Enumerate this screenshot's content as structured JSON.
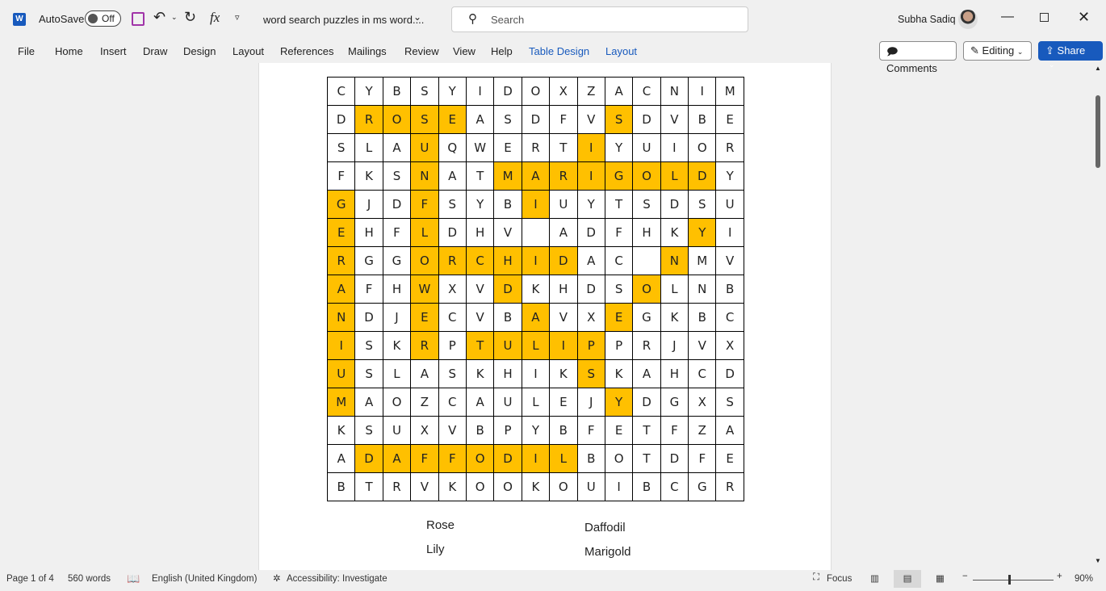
{
  "titlebar": {
    "autosave_label": "AutoSave",
    "autosave_state": "Off",
    "doc_title": "word search puzzles in ms word....",
    "search_placeholder": "Search",
    "user_name": "Subha Sadiq"
  },
  "menu": [
    "File",
    "Home",
    "Insert",
    "Draw",
    "Design",
    "Layout",
    "References",
    "Mailings",
    "Review",
    "View",
    "Help",
    "Table Design",
    "Layout"
  ],
  "actions": {
    "comments": "Comments",
    "editing": "Editing",
    "share": "Share"
  },
  "colors": {
    "highlight": "#ffc000",
    "accent": "#185abd",
    "contextual_tab": "#185abd"
  },
  "grid": {
    "rows": [
      "CYBSYIDOXZACNIM",
      "DROSEASDFVSDVBE",
      "SLAUQWERTIYUIOR",
      "FKSNATMARIGOLDY",
      "GJDFSYBIUYTSDSU",
      "EHFLDHV ADFHKYI",
      "RGGORCHIDAC NMV",
      "AFHWXVDKHDSOLNB",
      "NDJECVBAVXEGKBC",
      "ISKRPTULIPPRJVX",
      "USLASKHIKSKAHCD",
      "MAOZCAULEJYDGXS",
      "KSUXVBPYBFETFZA",
      "ADAFFODILBOTDFE",
      "BTRVKOOKOUIBCGR"
    ],
    "highlight_mask": [
      "000000000000000",
      "011110000010000",
      "000100000100000",
      "000100111111110",
      "100100010000000",
      "100100000000010",
      "100111111000100",
      "100100100001000",
      "100100010010000",
      "100101111100000",
      "100000000100000",
      "100000000010000",
      "000000000000000",
      "011111111000000",
      "000000000000000"
    ]
  },
  "word_list": {
    "col1": [
      "Rose",
      "Lily"
    ],
    "col2": [
      "Daffodil",
      "Marigold"
    ]
  },
  "status": {
    "page": "Page 1 of 4",
    "words": "560 words",
    "language": "English (United Kingdom)",
    "accessibility": "Accessibility: Investigate",
    "focus": "Focus",
    "zoom": "90%"
  }
}
